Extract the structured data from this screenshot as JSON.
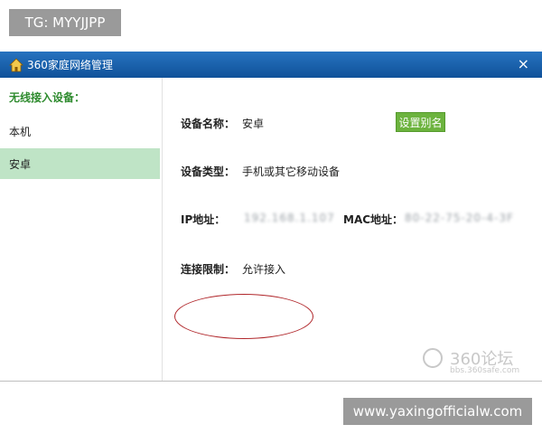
{
  "overlay": {
    "tg_label": "TG: MYYJJPP",
    "site_label": "www.yaxingofficialw.com"
  },
  "window": {
    "title": "360家庭网络管理",
    "close_glyph": "×",
    "accent_color": "#155fa8"
  },
  "sidebar": {
    "heading": "无线接入设备：",
    "items": [
      {
        "label": "本机",
        "selected": false
      },
      {
        "label": "安卓",
        "selected": true
      }
    ],
    "selected_color": "#bfe4c6"
  },
  "device": {
    "name_label": "设备名称：",
    "name_value": "安卓",
    "rename_button": "设置别名",
    "type_label": "设备类型：",
    "type_value": "手机或其它移动设备",
    "ip_label": "IP地址：",
    "ip_value": "192.168.1.107",
    "mac_label": "MAC地址：",
    "mac_value": "80-22-75-20-4-3F",
    "limit_label": "连接限制：",
    "limit_value": "允许接入"
  },
  "watermark": {
    "brand": "360论坛",
    "url": "bbs.360safe.com"
  }
}
